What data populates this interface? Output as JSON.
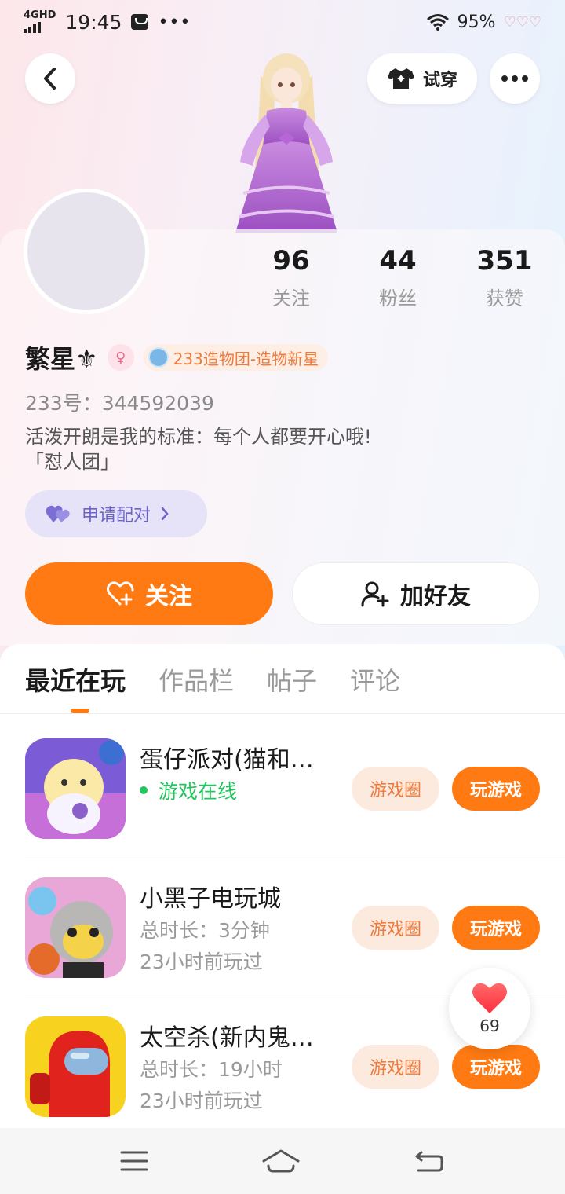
{
  "status": {
    "network": "4GHD",
    "time": "19:45",
    "battery": "95%"
  },
  "header": {
    "try_on_label": "试穿"
  },
  "profile": {
    "stats": [
      {
        "value": "96",
        "label": "关注"
      },
      {
        "value": "44",
        "label": "粉丝"
      },
      {
        "value": "351",
        "label": "获赞"
      }
    ],
    "name": "繁星⚜",
    "rank_label": "233造物团-造物新星",
    "uid": "233号：344592039",
    "bio_line1": "活泼开朗是我的标准：每个人都要开心哦!",
    "bio_line2": "「怼人团」",
    "pair_label": "申请配对",
    "follow_label": "关注",
    "add_friend_label": "加好友"
  },
  "tabs": [
    {
      "label": "最近在玩",
      "active": true
    },
    {
      "label": "作品栏",
      "active": false
    },
    {
      "label": "帖子",
      "active": false
    },
    {
      "label": "评论",
      "active": false
    }
  ],
  "games": [
    {
      "title": "蛋仔派对(猫和…",
      "status": "游戏在线",
      "circle_label": "游戏圈",
      "play_label": "玩游戏"
    },
    {
      "title": "小黑子电玩城",
      "duration": "总时长：3分钟",
      "last_played": "23小时前玩过",
      "circle_label": "游戏圈",
      "play_label": "玩游戏"
    },
    {
      "title": "太空杀(新内鬼…",
      "duration": "总时长：19小时",
      "last_played": "23小时前玩过",
      "circle_label": "游戏圈",
      "play_label": "玩游戏"
    }
  ],
  "like": {
    "count": "69"
  },
  "colors": {
    "accent": "#ff7a12",
    "online": "#22c55e",
    "pair": "#6c63c9"
  }
}
